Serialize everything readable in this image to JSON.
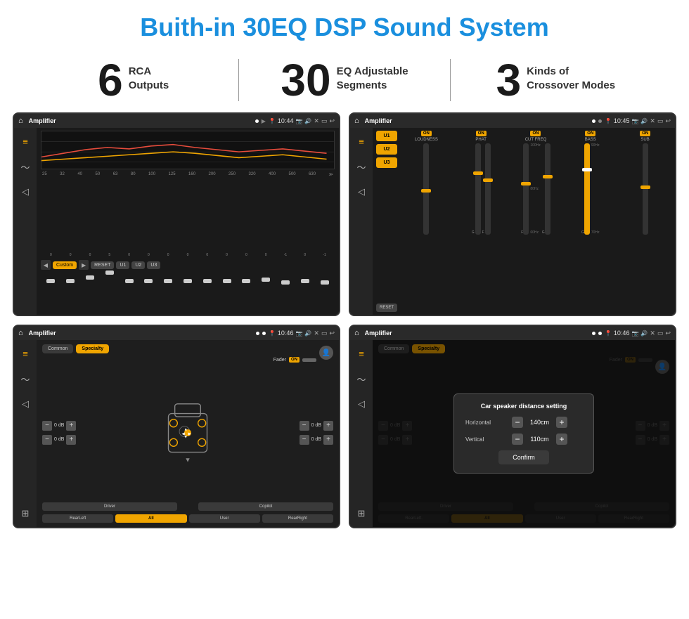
{
  "page": {
    "title": "Buith-in 30EQ DSP Sound System",
    "stats": [
      {
        "number": "6",
        "text_line1": "RCA",
        "text_line2": "Outputs"
      },
      {
        "number": "30",
        "text_line1": "EQ Adjustable",
        "text_line2": "Segments"
      },
      {
        "number": "3",
        "text_line1": "Kinds of",
        "text_line2": "Crossover Modes"
      }
    ]
  },
  "screen1": {
    "title": "Amplifier",
    "time": "10:44",
    "eq_labels": [
      "25",
      "32",
      "40",
      "50",
      "63",
      "80",
      "100",
      "125",
      "160",
      "200",
      "250",
      "320",
      "400",
      "500",
      "630"
    ],
    "bottom_btns": [
      "Custom",
      "RESET",
      "U1",
      "U2",
      "U3"
    ]
  },
  "screen2": {
    "title": "Amplifier",
    "time": "10:45",
    "channels": [
      "LOUDNESS",
      "PHAT",
      "CUT FREQ",
      "BASS",
      "SUB"
    ],
    "u_buttons": [
      "U1",
      "U2",
      "U3"
    ],
    "reset_label": "RESET"
  },
  "screen3": {
    "title": "Amplifier",
    "time": "10:46",
    "tabs": [
      "Common",
      "Specialty"
    ],
    "fader_label": "Fader",
    "fader_on": "ON",
    "btns": [
      "Driver",
      "",
      "Copilot",
      "RearLeft",
      "All",
      "User",
      "RearRight"
    ],
    "db_values": [
      "0 dB",
      "0 dB",
      "0 dB",
      "0 dB"
    ]
  },
  "screen4": {
    "title": "Amplifier",
    "time": "10:46",
    "tabs": [
      "Common",
      "Specialty"
    ],
    "dialog": {
      "title": "Car speaker distance setting",
      "horizontal_label": "Horizontal",
      "horizontal_value": "140cm",
      "vertical_label": "Vertical",
      "vertical_value": "110cm",
      "confirm_label": "Confirm"
    },
    "btns": [
      "Driver",
      "",
      "Copilot",
      "RearLeft.",
      "All",
      "User",
      "RearRight"
    ]
  }
}
